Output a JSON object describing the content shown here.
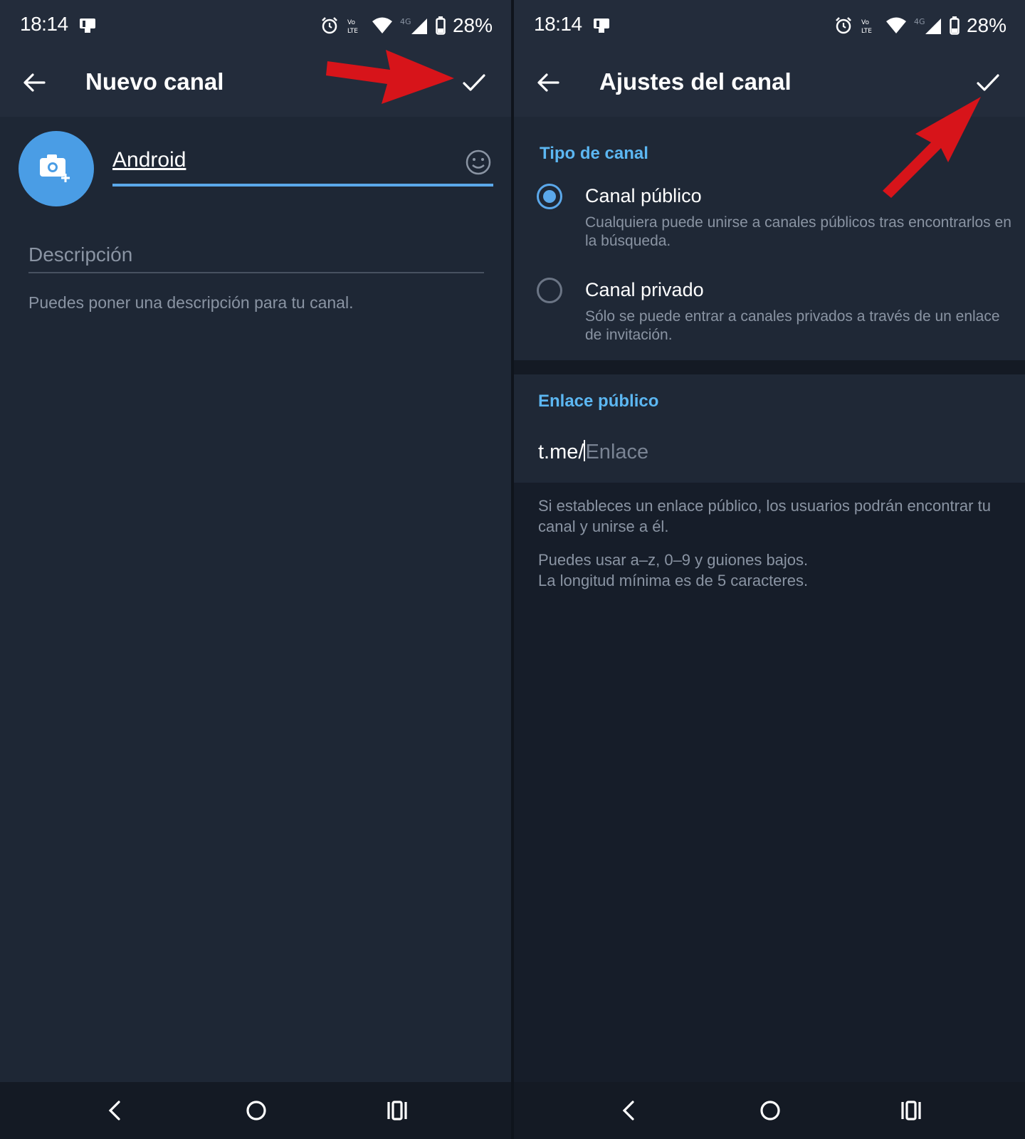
{
  "left": {
    "status": {
      "time": "18:14",
      "battery": "28%"
    },
    "toolbar": {
      "title": "Nuevo canal"
    },
    "channel_name": "Android",
    "description_placeholder": "Descripción",
    "description_hint": "Puedes poner una descripción para tu canal."
  },
  "right": {
    "status": {
      "time": "18:14",
      "battery": "28%"
    },
    "toolbar": {
      "title": "Ajustes del canal"
    },
    "channel_type_title": "Tipo de canal",
    "options": [
      {
        "label": "Canal público",
        "description": "Cualquiera puede unirse a canales públicos tras encontrarlos en la búsqueda.",
        "selected": true
      },
      {
        "label": "Canal privado",
        "description": "Sólo se puede entrar a canales privados a través de un enlace de invitación.",
        "selected": false
      }
    ],
    "public_link_title": "Enlace público",
    "link_prefix": "t.me/",
    "link_placeholder": "Enlace",
    "info_1": "Si estableces un enlace público, los usuarios podrán encontrar tu canal y unirse a él.",
    "info_2a": "Puedes usar a–z, 0–9 y guiones bajos.",
    "info_2b": "La longitud mínima es de 5 caracteres."
  },
  "icons": [
    "back-arrow-icon",
    "check-icon",
    "camera-add-icon",
    "emoji-icon",
    "alarm-icon",
    "volte-icon",
    "wifi-icon",
    "signal-icon",
    "battery-icon",
    "nav-back-icon",
    "nav-home-icon",
    "nav-recents-icon"
  ],
  "colors": {
    "accent": "#5ba8ea",
    "section_title": "#5cb7f2",
    "background": "#1e2735",
    "annotation_arrow": "#d7141a"
  }
}
